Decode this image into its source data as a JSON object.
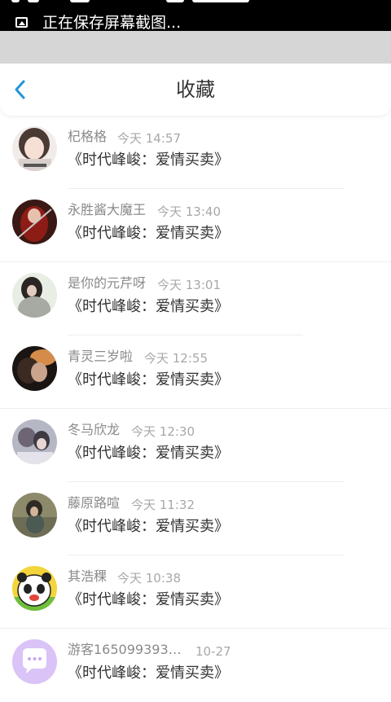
{
  "status_bar": {
    "text": "正在保存屏幕截图..."
  },
  "header": {
    "title": "收藏"
  },
  "favorites": [
    {
      "name": "杞格格",
      "time": "今天 14:57",
      "book": "《时代峰峻：爱情买卖》"
    },
    {
      "name": "永胜酱大魔王",
      "time": "今天 13:40",
      "book": "《时代峰峻：爱情买卖》"
    },
    {
      "name": "是你的元芹呀",
      "time": "今天 13:01",
      "book": "《时代峰峻：爱情买卖》"
    },
    {
      "name": "青灵三岁啦",
      "time": "今天 12:55",
      "book": "《时代峰峻：爱情买卖》"
    },
    {
      "name": "冬马欣龙",
      "time": "今天 12:30",
      "book": "《时代峰峻：爱情买卖》"
    },
    {
      "name": "藤原路喧",
      "time": "今天 11:32",
      "book": "《时代峰峻：爱情买卖》"
    },
    {
      "name": "其浩稞",
      "time": "今天 10:38",
      "book": "《时代峰峻：爱情买卖》"
    },
    {
      "name": "游客1650993931...",
      "time": "10-27",
      "book": "《时代峰峻：爱情买卖》"
    }
  ],
  "colors": {
    "accent": "#2196d9",
    "status_bar": "#000000",
    "gray_bar": "#d6d6d6",
    "name_text": "#8a8a8a",
    "time_text": "#a8a8a8",
    "book_text": "#333333"
  }
}
